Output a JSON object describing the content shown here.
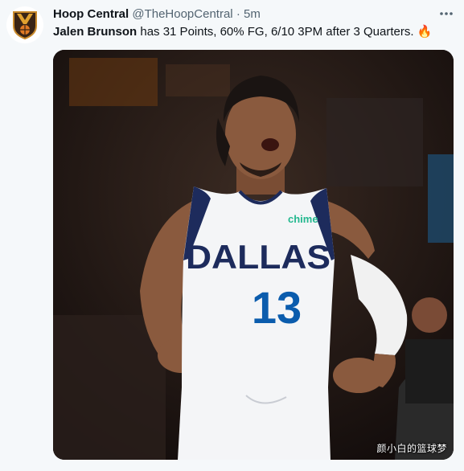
{
  "account": {
    "display_name": "Hoop Central",
    "handle": "@TheHoopCentral",
    "separator": "·",
    "time": "5m",
    "avatar_icon": "hoop-central-logo"
  },
  "tweet": {
    "player_name": "Jalen Brunson",
    "body": " has 31 Points, 60% FG, 6/10 3PM after 3 Quarters. ",
    "emoji": "🔥",
    "more_icon": "more-dots-icon"
  },
  "media": {
    "jersey_text": "DALLAS",
    "jersey_number": "13",
    "sponsor_text": "chime",
    "watermark": "颜小白的篮球梦"
  },
  "colors": {
    "name_text": "#0f1419",
    "meta_text": "#536471",
    "background": "#f5f8fa",
    "jersey_navy": "#1d2b5c",
    "jersey_blue": "#0b5cad",
    "sponsor_green": "#24b88f"
  }
}
